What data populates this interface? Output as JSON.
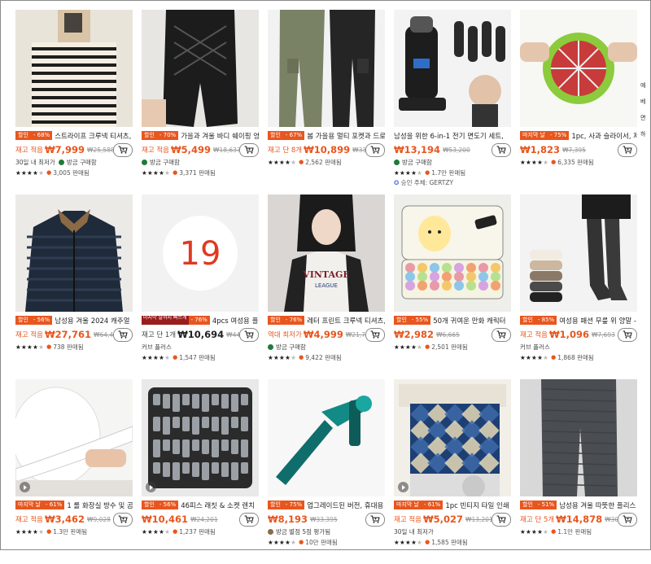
{
  "products": [
    {
      "badge": "할인",
      "badge_pct": "- 68%",
      "title": "스트라이프 크루넥 티셔츠,",
      "plabel": "재고 적음",
      "price": "₩7,999",
      "orig": "₩25,588",
      "meta": "30일 내 최저가",
      "meta2": "방금 구매함",
      "stars": 4.5,
      "sold": "3,005 판매됨",
      "video": false
    },
    {
      "badge": "할인",
      "badge_pct": "- 70%",
      "title": "가을과 겨울 바디 쉐이핑 엉",
      "plabel": "재고 적음",
      "price": "₩5,499",
      "orig": "₩18,637",
      "meta": "",
      "meta2": "방금 구매함",
      "stars": 4.5,
      "sold": "3,371 판매됨",
      "video": false
    },
    {
      "badge": "할인",
      "badge_pct": "- 67%",
      "title": "봄 가을용 멀티 포켓과 드로",
      "plabel": "재고 단 8개",
      "price": "₩10,899",
      "orig": "₩33,889",
      "meta": "",
      "meta2": "",
      "stars": 4.5,
      "sold": "2,562 판매됨",
      "video": false
    },
    {
      "badge": "",
      "badge_pct": "",
      "title": "남성을 위한 6-in-1 전기 면도기 세트,",
      "plabel": "",
      "price": "₩13,194",
      "orig": "₩53,200",
      "meta": "",
      "meta2": "방금 구매함",
      "stars": 4.5,
      "sold": "1.7만 판매됨",
      "extra": "승인 주체: GERTZY",
      "video": false
    },
    {
      "badge": "마지막 날",
      "badge_pct": "- 75%",
      "title": "1pc, 사과 슬라이서, 제",
      "plabel": "",
      "price": "₩1,823",
      "orig": "₩7,395",
      "meta": "",
      "meta2": "",
      "stars": 4.5,
      "sold": "6,335 판매됨",
      "video": false
    },
    {
      "badge": "할인",
      "badge_pct": "- 56%",
      "title": "남성용 겨울 2024 캐주얼",
      "plabel": "재고 적음",
      "price": "₩27,761",
      "orig": "₩64,439",
      "meta": "",
      "meta2": "",
      "stars": 4.5,
      "sold": "738 판매됨",
      "video": false
    },
    {
      "badge": "마지막 날까지 빠르게",
      "badge_pct": "- 76%",
      "title": "4pcs 여성용 플러스 에로",
      "plabel": "재고 단 1개",
      "price": "₩10,694",
      "orig": "₩44,973",
      "meta": "커브 플러스",
      "meta2": "",
      "stars": 4.5,
      "sold": "1,547 판매됨",
      "video": false,
      "countdown": "19"
    },
    {
      "badge": "할인",
      "badge_pct": "- 76%",
      "title": "레터 프린트 크루넥 티셔츠,",
      "plabel": "역대 최저가",
      "price": "₩4,999",
      "orig": "₩21,708",
      "meta": "",
      "meta2": "방금 구매함",
      "stars": 4.5,
      "sold": "9,422 판매됨",
      "video": false
    },
    {
      "badge": "할인",
      "badge_pct": "- 55%",
      "title": "50개 귀여운 만화 캐릭터",
      "plabel": "",
      "price": "₩2,982",
      "orig": "₩6,665",
      "meta": "",
      "meta2": "",
      "stars": 4.5,
      "sold": "2,501 판매됨",
      "video": false
    },
    {
      "badge": "할인",
      "badge_pct": "- 85%",
      "title": "여성용 패션 무릎 위 양말 -",
      "plabel": "재고 적음",
      "price": "₩1,096",
      "orig": "₩7,693",
      "meta": "커브 플러스",
      "meta2": "",
      "stars": 4.5,
      "sold": "1,868 판매됨",
      "video": false
    },
    {
      "badge": "마지막 날",
      "badge_pct": "- 61%",
      "title": "1 롤 화장실 방수 및 곰",
      "plabel": "재고 적음",
      "price": "₩3,462",
      "orig": "₩9,028",
      "meta": "",
      "meta2": "",
      "stars": 4.5,
      "sold": "1.3만 판매됨",
      "video": true
    },
    {
      "badge": "할인",
      "badge_pct": "- 56%",
      "title": "46피스 래칫 & 소켓 렌치",
      "plabel": "",
      "price": "₩10,461",
      "orig": "₩24,201",
      "meta": "",
      "meta2": "",
      "stars": 4.5,
      "sold": "1,237 판매됨",
      "video": true
    },
    {
      "badge": "할인",
      "badge_pct": "- 75%",
      "title": "업그레이드된 버전, 휴대용",
      "plabel": "",
      "price": "₩8,193",
      "orig": "₩33,395",
      "meta": "",
      "meta2": "방금 별점 5점 평가됨",
      "stars": 4.5,
      "sold": "10만 판매됨",
      "video": false
    },
    {
      "badge": "마지막 날",
      "badge_pct": "- 61%",
      "title": "1pc 빈티지 타일 인쇄",
      "plabel": "재고 적음",
      "price": "₩5,027",
      "orig": "₩13,201",
      "meta": "30일 내 최저가",
      "meta2": "",
      "stars": 4.5,
      "sold": "1,585 판매됨",
      "video": true
    },
    {
      "badge": "할인",
      "badge_pct": "- 51%",
      "title": "남성용 겨울 따뜻한 플리스",
      "plabel": "재고 단 5개",
      "price": "₩14,878",
      "orig": "₩30,539",
      "meta": "",
      "meta2": "",
      "stars": 4.5,
      "sold": "1.1만 판매됨",
      "video": false
    }
  ],
  "side": {
    "texts": [
      "예",
      "베",
      "면",
      "하"
    ]
  },
  "colors": {
    "accent": "#e8561e",
    "badge_red": "#e8561e",
    "badge_dark": "#9a1d1d"
  }
}
